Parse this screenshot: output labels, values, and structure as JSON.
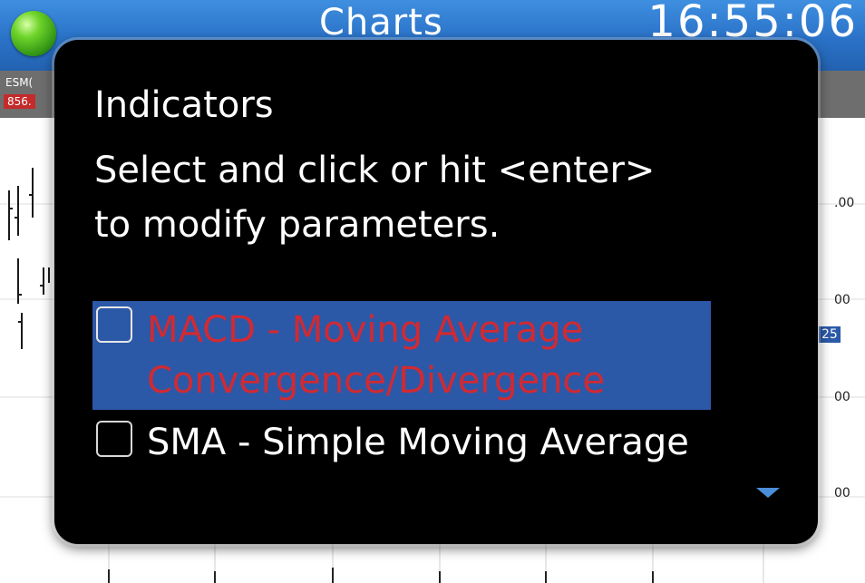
{
  "header": {
    "title": "Charts",
    "clock": "16:55:06"
  },
  "symbol": {
    "name": "ESM(",
    "price": "856."
  },
  "chart": {
    "price_labels": [
      ".00",
      "00",
      "00",
      "00"
    ],
    "highlighted_price": "25"
  },
  "dialog": {
    "title": "Indicators",
    "instructions": "Select and click or hit <enter> to modify parameters.",
    "options": [
      {
        "label": "MACD - Moving Average Convergence/Divergence",
        "checked": false,
        "selected": true
      },
      {
        "label": "SMA - Simple Moving Average",
        "checked": false,
        "selected": false
      }
    ]
  },
  "colors": {
    "titlebar": "#2a72c8",
    "selection": "#2c58a8",
    "selected_text": "#d12a32",
    "dialog_bg": "#000000"
  },
  "icons": {
    "status": "green-led-icon",
    "scroll": "triangle-down-icon"
  }
}
